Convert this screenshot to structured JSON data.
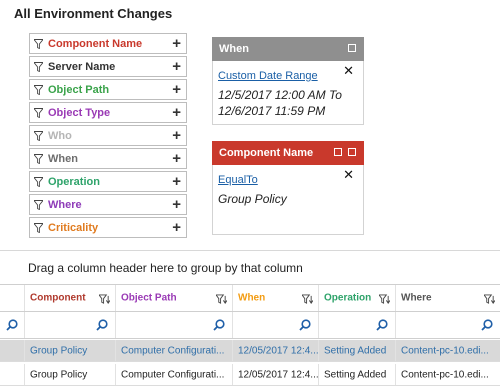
{
  "page_title": "All Environment Changes",
  "filter_list": {
    "items": [
      {
        "label": "Component Name",
        "color": "#c9392c"
      },
      {
        "label": "Server Name",
        "color": "#333333"
      },
      {
        "label": "Object Path",
        "color": "#3aa34a"
      },
      {
        "label": "Object Type",
        "color": "#9a3ab5"
      },
      {
        "label": "Who",
        "color": "#b5b5b5"
      },
      {
        "label": "When",
        "color": "#6d6d6d"
      },
      {
        "label": "Operation",
        "color": "#2ea36a"
      },
      {
        "label": "Where",
        "color": "#8e3bb8"
      },
      {
        "label": "Criticality",
        "color": "#e07b1f"
      }
    ],
    "add_icon": "+"
  },
  "cards": {
    "when": {
      "title": "When",
      "link": "Custom Date Range",
      "close": "✕",
      "value_line1": "12/5/2017 12:00 AM To",
      "value_line2": "12/6/2017 11:59 PM"
    },
    "component": {
      "title": "Component Name",
      "link": "EqualTo",
      "close": "✕",
      "value": "Group Policy"
    }
  },
  "grid": {
    "group_panel": "Drag a column header here to group by that column",
    "columns": [
      {
        "label": "Component",
        "color": "#b03a2e"
      },
      {
        "label": "Object Path",
        "color": "#9a3ab5"
      },
      {
        "label": "When",
        "color": "#f39c12"
      },
      {
        "label": "Operation",
        "color": "#2ea36a"
      },
      {
        "label": "Where",
        "color": "#555555"
      }
    ],
    "rows": [
      [
        "Group Policy",
        "Computer Configurati...",
        "12/05/2017 12:4...",
        "Setting Added",
        "Content-pc-10.edi..."
      ],
      [
        "Group Policy",
        "Computer Configurati...",
        "12/05/2017 12:4...",
        "Setting Added",
        "Content-pc-10.edi..."
      ]
    ]
  }
}
